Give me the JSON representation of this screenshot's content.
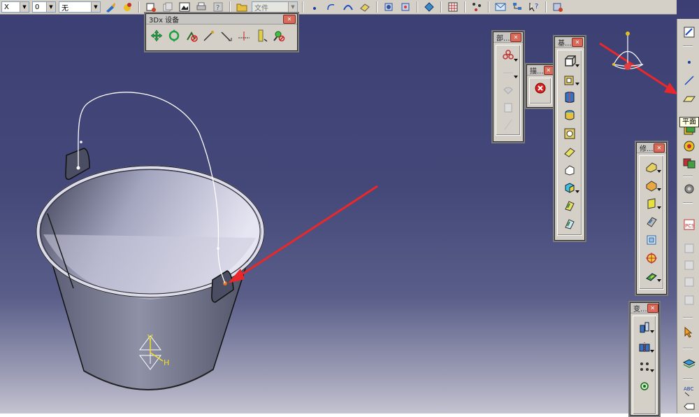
{
  "toolbar": {
    "combo_1": "X",
    "combo_2": "0",
    "combo_3": "无",
    "combo_4": "文件"
  },
  "panel_3dx": {
    "title": "3Dx 设备"
  },
  "panel_sketch": {
    "title": "部..."
  },
  "panel_constraint": {
    "title": "描..."
  },
  "panel_basic": {
    "title": "基..."
  },
  "panel_modify": {
    "title": "修..."
  },
  "panel_transform": {
    "title": "变..."
  },
  "tooltip": {
    "text": "平面"
  },
  "model": {
    "axis_v": "V",
    "axis_h": "H"
  },
  "colors": {
    "background_top": "#3c3f73",
    "background_bottom": "#c4c4d2",
    "annotation_arrow": "#e8282a",
    "model_handle_point": "#e07020"
  },
  "icons": [
    "move-icon",
    "rotate-icon",
    "line-icon",
    "plane-icon",
    "close-icon",
    "folder-icon",
    "help-icon",
    "compass-icon"
  ]
}
